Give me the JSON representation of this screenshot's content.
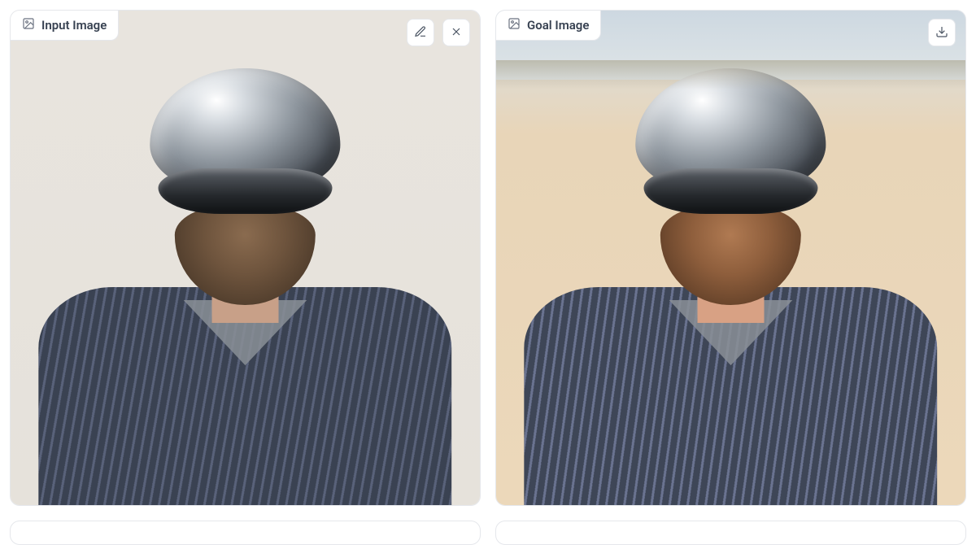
{
  "panels": {
    "input": {
      "label": "Input Image",
      "actions": {
        "edit": "Edit",
        "remove": "Remove"
      },
      "image_description": "Bearded man in a blue-grey striped button-up shirt wearing a reflective chrome helmet with a dark mirrored visor, arms crossed, neutral indoor beige background."
    },
    "goal": {
      "label": "Goal Image",
      "actions": {
        "download": "Download"
      },
      "image_description": "Same bearded man in the striped shirt and chrome helmet with visor, now against a sunlit sandy desert with sparse shrubs and a pale sky at the horizon; warmer skin tones."
    }
  }
}
